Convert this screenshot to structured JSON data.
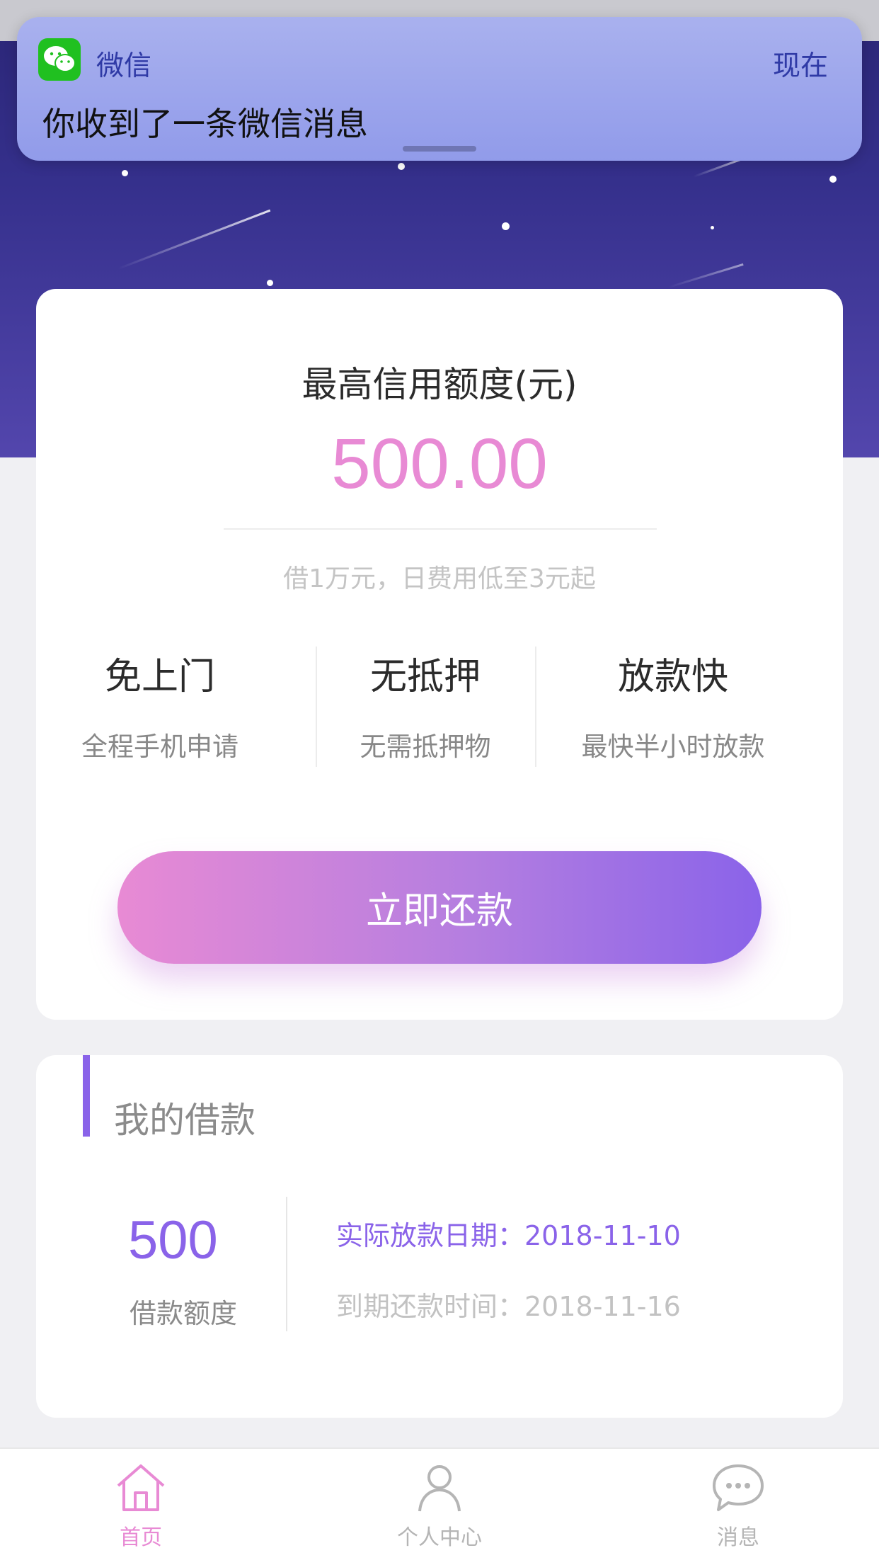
{
  "notification": {
    "app_name": "微信",
    "time": "现在",
    "message": "你收到了一条微信消息",
    "icon": "wechat-icon"
  },
  "credit": {
    "title": "最高信用额度(元)",
    "amount": "500.00",
    "note": "借1万元，日费用低至3元起"
  },
  "features": [
    {
      "title": "免上门",
      "subtitle": "全程手机申请"
    },
    {
      "title": "无抵押",
      "subtitle": "无需抵押物"
    },
    {
      "title": "放款快",
      "subtitle": "最快半小时放款"
    }
  ],
  "repay_button": "立即还款",
  "loan": {
    "section_title": "我的借款",
    "amount": "500",
    "amount_label": "借款额度",
    "disburse_date": "实际放款日期：2018-11-10",
    "due_date": "到期还款时间：2018-11-16"
  },
  "tabbar": {
    "items": [
      {
        "label": "首页",
        "icon": "home-icon",
        "active": true
      },
      {
        "label": "个人中心",
        "icon": "person-icon",
        "active": false
      },
      {
        "label": "消息",
        "icon": "chat-icon",
        "active": false
      }
    ]
  },
  "colors": {
    "accent_pink": "#e88ad4",
    "accent_purple": "#8a63e9",
    "hero_dark": "#2a2575",
    "inactive": "#b5b5b5"
  }
}
